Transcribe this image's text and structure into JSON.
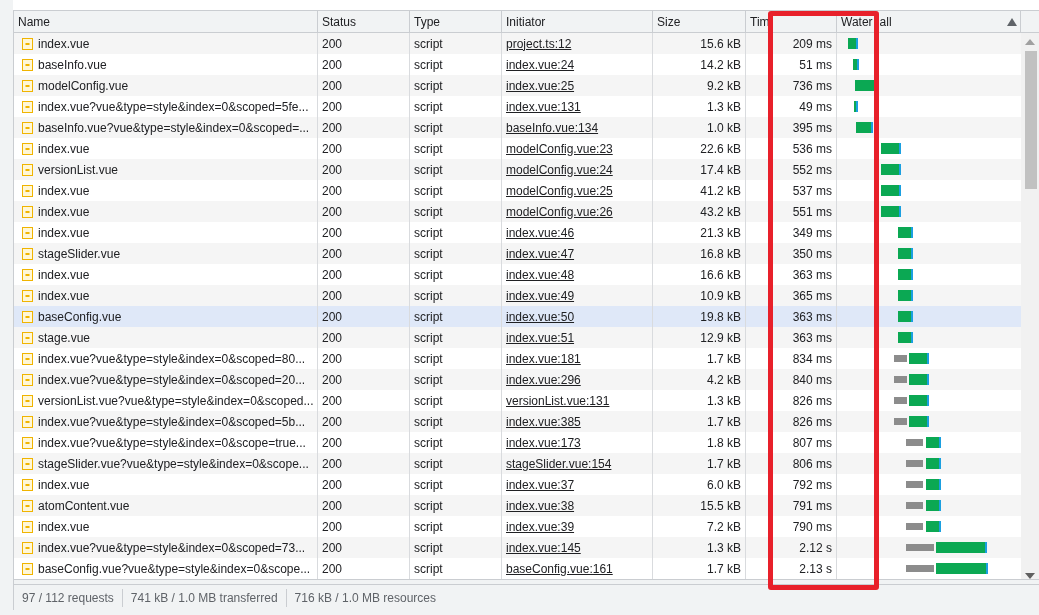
{
  "columns": [
    "Name",
    "Status",
    "Type",
    "Initiator",
    "Size",
    "Tim"
  ],
  "waterfall_header": [
    "Water",
    "all"
  ],
  "rows": [
    {
      "name": "index.vue",
      "status": "200",
      "type": "script",
      "initiator": "project.ts:12",
      "size": "15.6 kB",
      "time": "209 ms",
      "highlighted": false
    },
    {
      "name": "baseInfo.vue",
      "status": "200",
      "type": "script",
      "initiator": "index.vue:24",
      "size": "14.2 kB",
      "time": "51 ms",
      "highlighted": false
    },
    {
      "name": "modelConfig.vue",
      "status": "200",
      "type": "script",
      "initiator": "index.vue:25",
      "size": "9.2 kB",
      "time": "736 ms",
      "highlighted": false
    },
    {
      "name": "index.vue?vue&type=style&index=0&scoped=5fe...",
      "status": "200",
      "type": "script",
      "initiator": "index.vue:131",
      "size": "1.3 kB",
      "time": "49 ms",
      "highlighted": false
    },
    {
      "name": "baseInfo.vue?vue&type=style&index=0&scoped=...",
      "status": "200",
      "type": "script",
      "initiator": "baseInfo.vue:134",
      "size": "1.0 kB",
      "time": "395 ms",
      "highlighted": false
    },
    {
      "name": "index.vue",
      "status": "200",
      "type": "script",
      "initiator": "modelConfig.vue:23",
      "size": "22.6 kB",
      "time": "536 ms",
      "highlighted": false
    },
    {
      "name": "versionList.vue",
      "status": "200",
      "type": "script",
      "initiator": "modelConfig.vue:24",
      "size": "17.4 kB",
      "time": "552 ms",
      "highlighted": false
    },
    {
      "name": "index.vue",
      "status": "200",
      "type": "script",
      "initiator": "modelConfig.vue:25",
      "size": "41.2 kB",
      "time": "537 ms",
      "highlighted": false
    },
    {
      "name": "index.vue",
      "status": "200",
      "type": "script",
      "initiator": "modelConfig.vue:26",
      "size": "43.2 kB",
      "time": "551 ms",
      "highlighted": false
    },
    {
      "name": "index.vue",
      "status": "200",
      "type": "script",
      "initiator": "index.vue:46",
      "size": "21.3 kB",
      "time": "349 ms",
      "highlighted": false
    },
    {
      "name": "stageSlider.vue",
      "status": "200",
      "type": "script",
      "initiator": "index.vue:47",
      "size": "16.8 kB",
      "time": "350 ms",
      "highlighted": false
    },
    {
      "name": "index.vue",
      "status": "200",
      "type": "script",
      "initiator": "index.vue:48",
      "size": "16.6 kB",
      "time": "363 ms",
      "highlighted": false
    },
    {
      "name": "index.vue",
      "status": "200",
      "type": "script",
      "initiator": "index.vue:49",
      "size": "10.9 kB",
      "time": "365 ms",
      "highlighted": false
    },
    {
      "name": "baseConfig.vue",
      "status": "200",
      "type": "script",
      "initiator": "index.vue:50",
      "size": "19.8 kB",
      "time": "363 ms",
      "highlighted": true
    },
    {
      "name": "stage.vue",
      "status": "200",
      "type": "script",
      "initiator": "index.vue:51",
      "size": "12.9 kB",
      "time": "363 ms",
      "highlighted": false
    },
    {
      "name": "index.vue?vue&type=style&index=0&scoped=80...",
      "status": "200",
      "type": "script",
      "initiator": "index.vue:181",
      "size": "1.7 kB",
      "time": "834 ms",
      "highlighted": false
    },
    {
      "name": "index.vue?vue&type=style&index=0&scoped=20...",
      "status": "200",
      "type": "script",
      "initiator": "index.vue:296",
      "size": "4.2 kB",
      "time": "840 ms",
      "highlighted": false
    },
    {
      "name": "versionList.vue?vue&type=style&index=0&scoped...",
      "status": "200",
      "type": "script",
      "initiator": "versionList.vue:131",
      "size": "1.3 kB",
      "time": "826 ms",
      "highlighted": false
    },
    {
      "name": "index.vue?vue&type=style&index=0&scoped=5b...",
      "status": "200",
      "type": "script",
      "initiator": "index.vue:385",
      "size": "1.7 kB",
      "time": "826 ms",
      "highlighted": false
    },
    {
      "name": "index.vue?vue&type=style&index=0&scope=true...",
      "status": "200",
      "type": "script",
      "initiator": "index.vue:173",
      "size": "1.8 kB",
      "time": "807 ms",
      "highlighted": false
    },
    {
      "name": "stageSlider.vue?vue&type=style&index=0&scope...",
      "status": "200",
      "type": "script",
      "initiator": "stageSlider.vue:154",
      "size": "1.7 kB",
      "time": "806 ms",
      "highlighted": false
    },
    {
      "name": "index.vue",
      "status": "200",
      "type": "script",
      "initiator": "index.vue:37",
      "size": "6.0 kB",
      "time": "792 ms",
      "highlighted": false
    },
    {
      "name": "atomContent.vue",
      "status": "200",
      "type": "script",
      "initiator": "index.vue:38",
      "size": "15.5 kB",
      "time": "791 ms",
      "highlighted": false
    },
    {
      "name": "index.vue",
      "status": "200",
      "type": "script",
      "initiator": "index.vue:39",
      "size": "7.2 kB",
      "time": "790 ms",
      "highlighted": false
    },
    {
      "name": "index.vue?vue&type=style&index=0&scoped=73...",
      "status": "200",
      "type": "script",
      "initiator": "index.vue:145",
      "size": "1.3 kB",
      "time": "2.12 s",
      "highlighted": false
    },
    {
      "name": "baseConfig.vue?vue&type=style&index=0&scope...",
      "status": "200",
      "type": "script",
      "initiator": "baseConfig.vue:161",
      "size": "1.7 kB",
      "time": "2.13 s",
      "highlighted": false
    }
  ],
  "status_bar": [
    "97 / 112 requests",
    "741 kB / 1.0 MB transferred",
    "716 kB / 1.0 MB resources"
  ]
}
